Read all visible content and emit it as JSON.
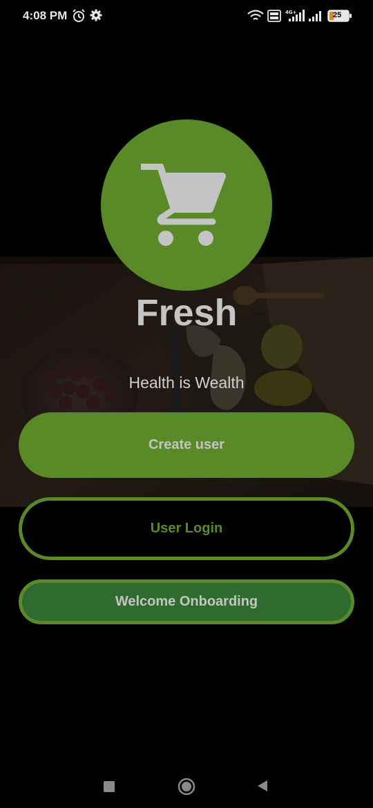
{
  "status_bar": {
    "time": "4:08 PM",
    "battery": "25",
    "icons": [
      "alarm-icon",
      "gear-icon",
      "wifi-icon",
      "volte-icon",
      "signal-4g-icon",
      "signal-icon",
      "battery-icon"
    ]
  },
  "app": {
    "title": "Fresh",
    "tagline": "Health is Wealth",
    "logo_icon": "shopping-cart-icon",
    "accent_color": "#5a8a28"
  },
  "buttons": {
    "create_user": "Create user",
    "user_login": "User Login",
    "welcome_onboarding": "Welcome Onboarding"
  },
  "nav_bar": {
    "icons": [
      "recent-apps-icon",
      "home-icon",
      "back-icon"
    ]
  }
}
